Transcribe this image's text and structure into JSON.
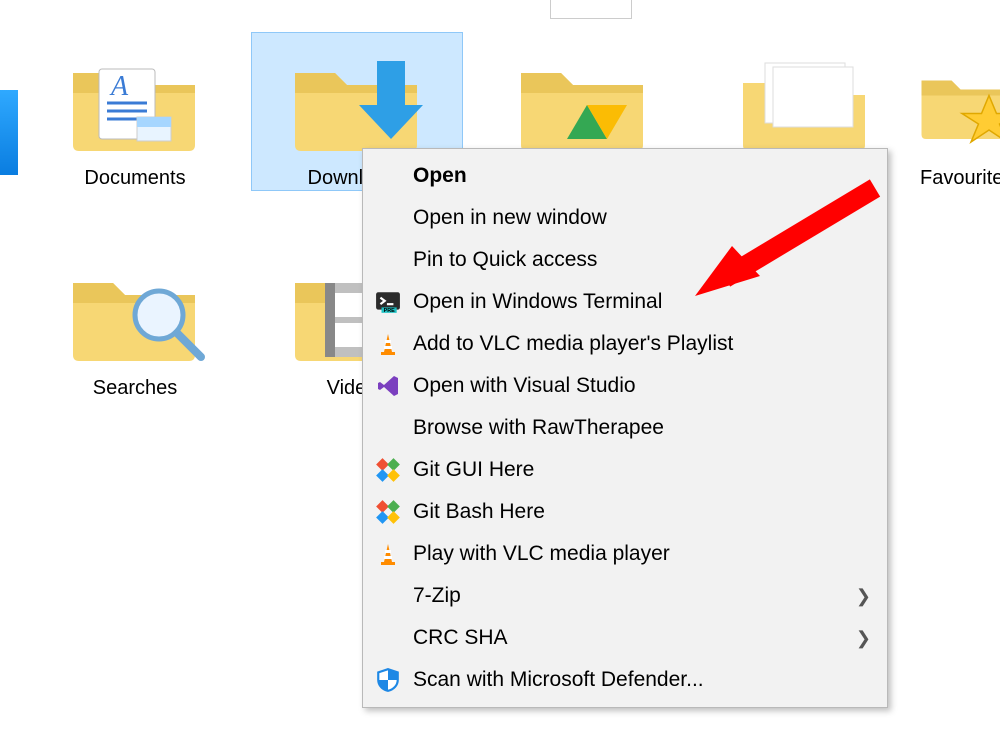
{
  "folders": {
    "documents": {
      "label": "Documents"
    },
    "downloads": {
      "label": "Downloads"
    },
    "drive": {
      "label": ""
    },
    "favourites": {
      "label": "Favourites"
    },
    "searches": {
      "label": "Searches"
    },
    "videos": {
      "label": "Videos"
    }
  },
  "menu": {
    "open": "Open",
    "open_new_win": "Open in new window",
    "pin_quick": "Pin to Quick access",
    "open_terminal": "Open in Windows Terminal",
    "vlc_playlist": "Add to VLC media player's Playlist",
    "visual_studio": "Open with Visual Studio",
    "rawtherapee": "Browse with RawTherapee",
    "git_gui": "Git GUI Here",
    "git_bash": "Git Bash Here",
    "vlc_play": "Play with VLC media player",
    "sevenzip": "7-Zip",
    "crc_sha": "CRC SHA",
    "defender": "Scan with Microsoft Defender..."
  }
}
